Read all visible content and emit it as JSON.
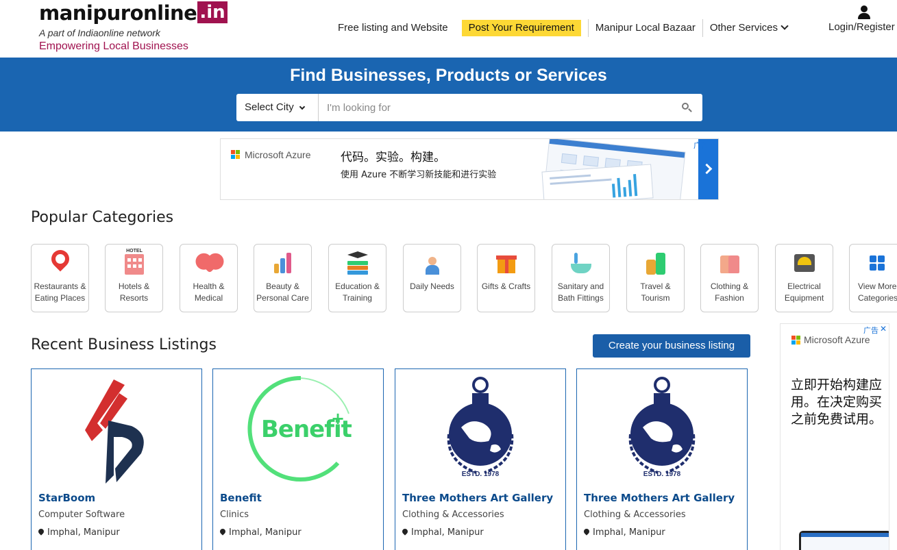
{
  "header": {
    "logo_main": "manipuronline",
    "logo_tld": ".in",
    "logo_tagline": "A part of Indiaonline network",
    "logo_slogan": "Empowering Local Businesses",
    "nav": {
      "free_listing": "Free listing and Website",
      "post_requirement": "Post Your Requirement",
      "local_bazaar": "Manipur Local Bazaar",
      "other_services": "Other Services",
      "login": "Login/Register"
    }
  },
  "search": {
    "title": "Find Businesses, Products or Services",
    "city_select": "Select City",
    "placeholder": "I'm looking for"
  },
  "ad_banner": {
    "brand": "Microsoft Azure",
    "headline": "代码。实验。构建。",
    "subline": "使用 Azure 不断学习新技能和进行实验",
    "ad_label": "广告",
    "close": "✕"
  },
  "popular_categories": {
    "title": "Popular Categories",
    "items": [
      {
        "line1": "Restaurants &",
        "line2": "Eating Places",
        "icon": "restaurant-pin-icon"
      },
      {
        "line1": "Hotels &",
        "line2": "Resorts",
        "icon": "hotel-icon",
        "sign": "HOTEL"
      },
      {
        "line1": "Health &",
        "line2": "Medical",
        "icon": "health-heart-icon"
      },
      {
        "line1": "Beauty &",
        "line2": "Personal Care",
        "icon": "beauty-icon"
      },
      {
        "line1": "Education &",
        "line2": "Training",
        "icon": "education-books-icon"
      },
      {
        "line1": "Daily Needs",
        "line2": "",
        "icon": "daily-needs-person-icon"
      },
      {
        "line1": "Gifts & Crafts",
        "line2": "",
        "icon": "gift-box-icon"
      },
      {
        "line1": "Sanitary and",
        "line2": "Bath Fittings",
        "icon": "bathtub-icon"
      },
      {
        "line1": "Travel &",
        "line2": "Tourism",
        "icon": "luggage-icon"
      },
      {
        "line1": "Clothing &",
        "line2": "Fashion",
        "icon": "clothing-icon"
      },
      {
        "line1": "Electrical",
        "line2": "Equipment",
        "icon": "electrical-meter-icon"
      },
      {
        "line1": "View More",
        "line2": "Categories",
        "icon": "grid-icon"
      }
    ]
  },
  "recent_listings": {
    "title": "Recent Business Listings",
    "create_button": "Create your business listing",
    "items": [
      {
        "name": "StarBoom",
        "category": "Computer Software",
        "location": "Imphal, Manipur"
      },
      {
        "name": "Benefit",
        "category": "Clinics",
        "location": "Imphal, Manipur",
        "logo_text": "Benefit",
        "logo_plus": "+"
      },
      {
        "name": "Three Mothers Art Gallery",
        "category": "Clothing & Accessories",
        "location": "Imphal, Manipur",
        "estd": "ESTD. 1978"
      },
      {
        "name": "Three Mothers Art Gallery",
        "category": "Clothing & Accessories",
        "location": "Imphal, Manipur",
        "estd": "ESTD. 1978"
      }
    ]
  },
  "side_ad": {
    "brand": "Microsoft Azure",
    "text": "立即开始构建应用。在决定购买之前免费试用。",
    "ad_label": "广告",
    "close": "✕"
  },
  "colors": {
    "brand_magenta": "#a0124f",
    "band_blue": "#1a65b1",
    "highlight_yellow": "#fdd835",
    "listing_title": "#0b4a8b"
  }
}
